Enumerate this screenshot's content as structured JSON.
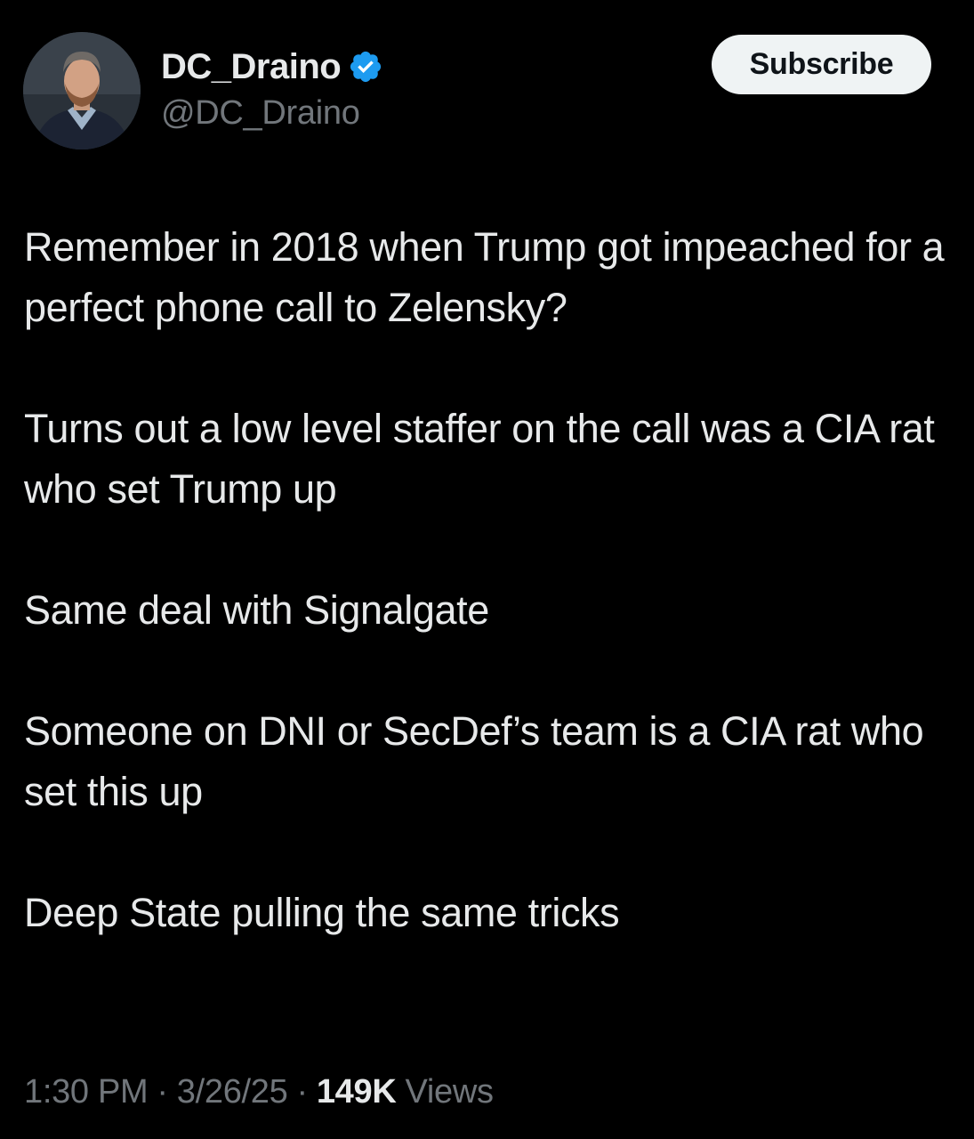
{
  "author": {
    "display_name": "DC_Draino",
    "handle": "@DC_Draino",
    "verified": true,
    "verified_color": "#1d9bf0"
  },
  "actions": {
    "subscribe_label": "Subscribe"
  },
  "tweet": {
    "paragraphs": [
      "Remember in 2018 when Trump got impeached for a perfect phone call to Zelensky?",
      "Turns out a low level staffer on the call was a CIA rat who set Trump up",
      "Same deal with Signalgate",
      "Someone on DNI or SecDef’s team is a CIA rat who set this up",
      "Deep State pulling the same tricks"
    ]
  },
  "meta": {
    "time": "1:30 PM",
    "separator": "·",
    "date": "3/26/25",
    "views_count": "149K",
    "views_label": "Views"
  },
  "colors": {
    "background": "#000000",
    "primary_text": "#e7e9ea",
    "secondary_text": "#71767b",
    "button_bg": "#eff3f4"
  },
  "icons": {
    "avatar": "avatar-photo",
    "verified": "verified-badge-icon"
  }
}
